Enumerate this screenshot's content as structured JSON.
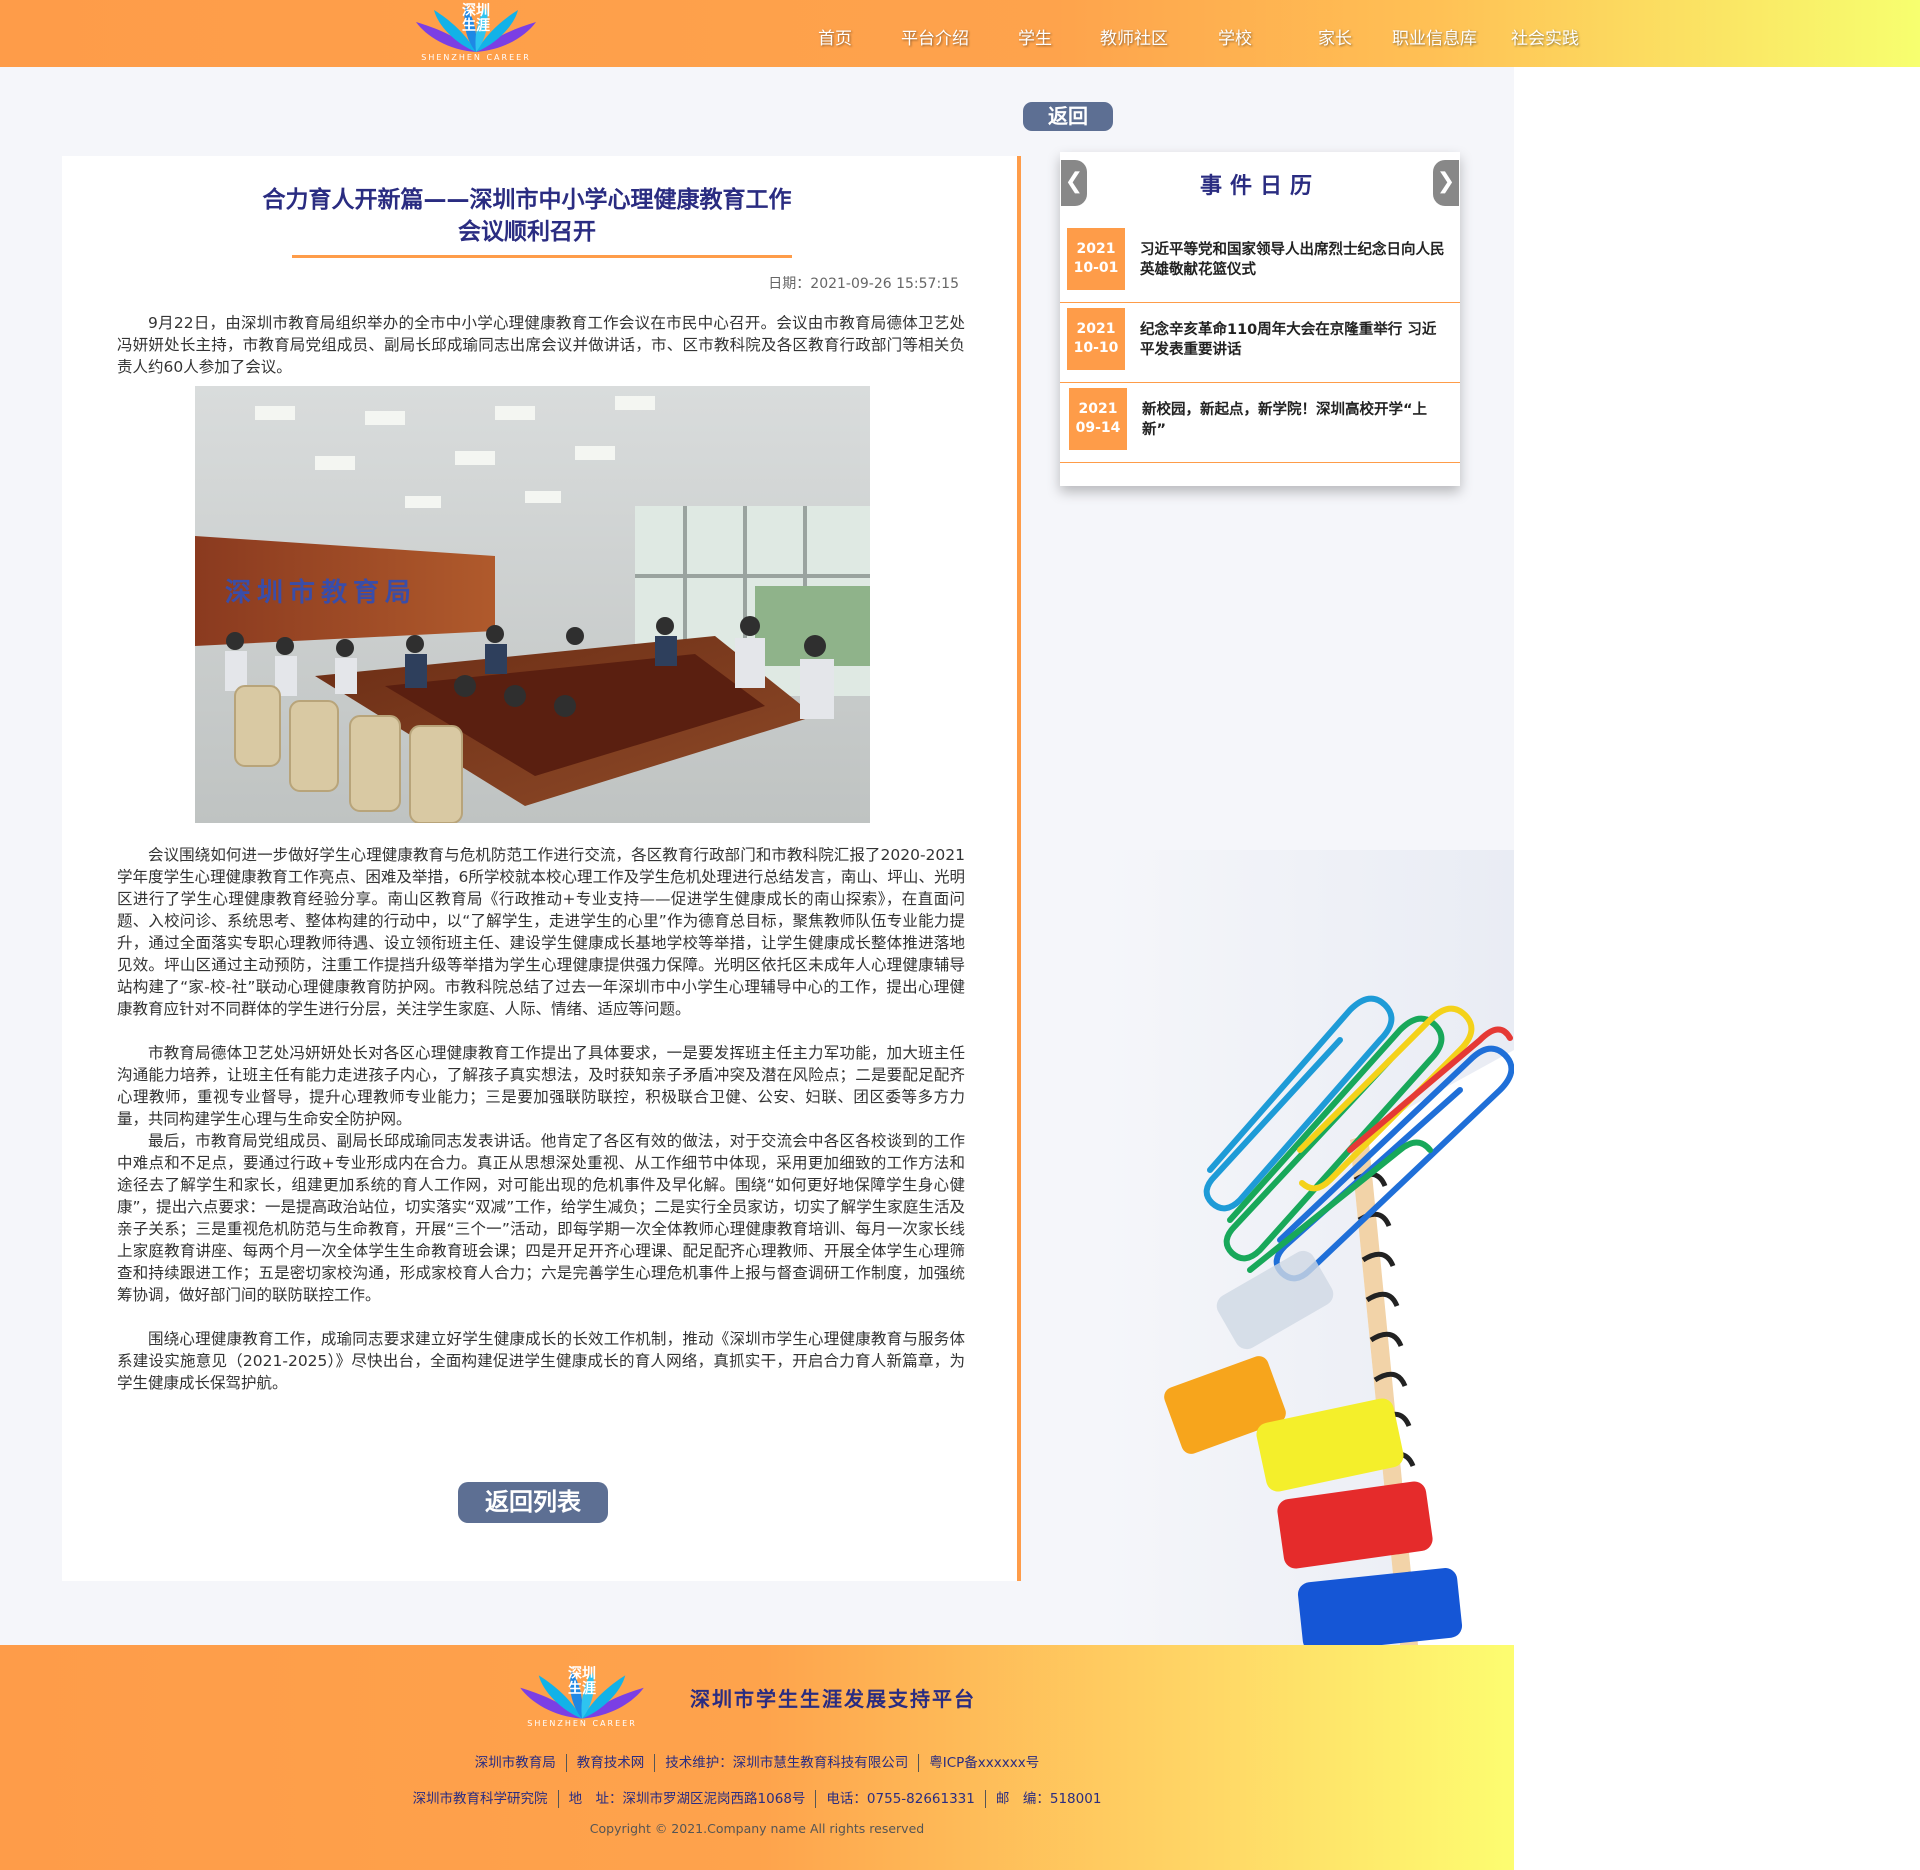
{
  "header": {
    "logo_cn_line1": "深圳",
    "logo_cn_line2": "生涯",
    "logo_en": "SHENZHEN CAREER",
    "nav": [
      "首页",
      "平台介绍",
      "学生",
      "教师社区",
      "学校",
      "家长",
      "职业信息库",
      "社会实践"
    ]
  },
  "back_button": "返回",
  "article": {
    "title_line1": "合力育人开新篇——深圳市中小学心理健康教育工作",
    "title_line2": "会议顺利召开",
    "date_label": "日期：",
    "date_value": "2021-09-26 15:57:15",
    "paragraphs": [
      "9月22日，由深圳市教育局组织举办的全市中小学心理健康教育工作会议在市民中心召开。会议由市教育局德体卫艺处冯妍妍处长主持，市教育局党组成员、副局长邱成瑜同志出席会议并做讲话，市、区市教科院及各区教育行政部门等相关负责人约60人参加了会议。",
      "会议围绕如何进一步做好学生心理健康教育与危机防范工作进行交流，各区教育行政部门和市教科院汇报了2020-2021学年度学生心理健康教育工作亮点、困难及举措，6所学校就本校心理工作及学生危机处理进行总结发言，南山、坪山、光明区进行了学生心理健康教育经验分享。南山区教育局《行政推动+专业支持——促进学生健康成长的南山探索》，在直面问题、入校问诊、系统思考、整体构建的行动中，以“了解学生，走进学生的心里”作为德育总目标，聚焦教师队伍专业能力提升，通过全面落实专职心理教师待遇、设立领衔班主任、建设学生健康成长基地学校等举措，让学生健康成长整体推进落地见效。坪山区通过主动预防，注重工作提挡升级等举措为学生心理健康提供强力保障。光明区依托区未成年人心理健康辅导站构建了“家-校-社”联动心理健康教育防护网。市教科院总结了过去一年深圳市中小学生心理辅导中心的工作，提出心理健康教育应针对不同群体的学生进行分层，关注学生家庭、人际、情绪、适应等问题。",
      "市教育局德体卫艺处冯妍妍处长对各区心理健康教育工作提出了具体要求，一是要发挥班主任主力军功能，加大班主任沟通能力培养，让班主任有能力走进孩子内心，了解孩子真实想法，及时获知亲子矛盾冲突及潜在风险点；二是要配足配齐心理教师，重视专业督导，提升心理教师专业能力；三是要加强联防联控，积极联合卫健、公安、妇联、团区委等多方力量，共同构建学生心理与生命安全防护网。",
      "最后，市教育局党组成员、副局长邱成瑜同志发表讲话。他肯定了各区有效的做法，对于交流会中各区各校谈到的工作中难点和不足点，要通过行政+专业形成内在合力。真正从思想深处重视、从工作细节中体现，采用更加细致的工作方法和途径去了解学生和家长，组建更加系统的育人工作网，对可能出现的危机事件及早化解。围绕“如何更好地保障学生身心健康”，提出六点要求：一是提高政治站位，切实落实“双减”工作，给学生减负；二是实行全员家访，切实了解学生家庭生活及亲子关系；三是重视危机防范与生命教育，开展“三个一”活动，即每学期一次全体教师心理健康教育培训、每月一次家长线上家庭教育讲座、每两个月一次全体学生生命教育班会课；四是开足开齐心理课、配足配齐心理教师、开展全体学生心理筛查和持续跟进工作；五是密切家校沟通，形成家校育人合力；六是完善学生心理危机事件上报与督查调研工作制度，加强统筹协调，做好部门间的联防联控工作。",
      "围绕心理健康教育工作，成瑜同志要求建立好学生健康成长的长效工作机制，推动《深圳市学生心理健康教育与服务体系建设实施意见（2021-2025）》尽快出台，全面构建促进学生健康成长的育人网络，真抓实干，开启合力育人新篇章，为学生健康成长保驾护航。"
    ],
    "photo_sign_text": "深圳市教育局",
    "return_list_button": "返回列表"
  },
  "calendar": {
    "title": "事件日历",
    "prev_icon": "chevron-left-icon",
    "next_icon": "chevron-right-icon",
    "events": [
      {
        "year": "2021",
        "day": "10-01",
        "text": "习近平等党和国家领导人出席烈士纪念日向人民英雄敬献花篮仪式"
      },
      {
        "year": "2021",
        "day": "10-10",
        "text": "纪念辛亥革命110周年大会在京隆重举行 习近平发表重要讲话"
      },
      {
        "year": "2021",
        "day": "09-14",
        "text": "新校园，新起点，新学院！深圳高校开学“上新”"
      }
    ]
  },
  "footer": {
    "logo_cn_line1": "深圳",
    "logo_cn_line2": "生涯",
    "logo_en": "SHENZHEN CAREER",
    "platform_name": "深圳市学生生涯发展支持平台",
    "line1": [
      "深圳市教育局",
      "教育技术网",
      "技术维护：深圳市慧生教育科技有限公司",
      "粤ICP备xxxxxx号"
    ],
    "line2": [
      "深圳市教育科学研究院",
      "地　址：深圳市罗湖区泥岗西路1068号",
      "电话：0755-82661331",
      "邮　编：518001"
    ],
    "copyright": "Copyright © 2021.Company name All rights reserved"
  },
  "colors": {
    "accent_orange": "#fe9c49",
    "title_navy": "#2a2c81",
    "button_slate": "#5d6f93"
  }
}
